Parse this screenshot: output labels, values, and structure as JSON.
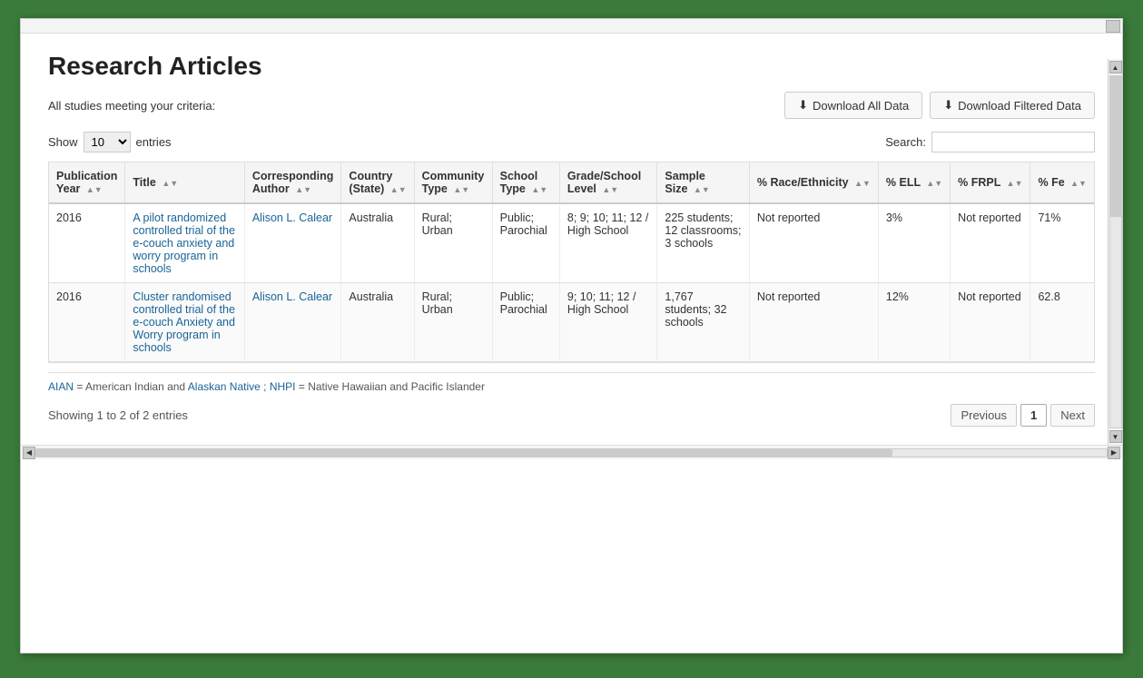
{
  "page": {
    "title": "Research Articles",
    "criteria_label": "All studies meeting your criteria:",
    "btn_download_all": "Download All Data",
    "btn_download_filtered": "Download Filtered Data",
    "show_label": "Show",
    "entries_label": "entries",
    "show_value": "10",
    "search_label": "Search:",
    "search_placeholder": ""
  },
  "table": {
    "columns": [
      {
        "id": "pub_year",
        "label": "Publication\nYear",
        "sortable": true
      },
      {
        "id": "title",
        "label": "Title",
        "sortable": true
      },
      {
        "id": "corresponding_author",
        "label": "Corresponding\nAuthor",
        "sortable": true
      },
      {
        "id": "country",
        "label": "Country\n(State)",
        "sortable": true
      },
      {
        "id": "community_type",
        "label": "Community\nType",
        "sortable": true
      },
      {
        "id": "school_type",
        "label": "School\nType",
        "sortable": true
      },
      {
        "id": "grade_level",
        "label": "Grade/School\nLevel",
        "sortable": true
      },
      {
        "id": "sample_size",
        "label": "Sample\nSize",
        "sortable": true
      },
      {
        "id": "race_ethnicity",
        "label": "% Race/Ethnicity",
        "sortable": true
      },
      {
        "id": "ell",
        "label": "% ELL",
        "sortable": true
      },
      {
        "id": "frpl",
        "label": "% FRPL",
        "sortable": true
      },
      {
        "id": "female",
        "label": "% Fe",
        "sortable": true
      }
    ],
    "rows": [
      {
        "pub_year": "2016",
        "title": "A pilot randomized controlled trial of the e-couch anxiety and worry program in schools",
        "corresponding_author": "Alison L. Calear",
        "country": "Australia",
        "community_type": "Rural; Urban",
        "school_type": "Public; Parochial",
        "grade_level": "8; 9; 10; 11; 12 / High School",
        "sample_size": "225 students; 12 classrooms; 3 schools",
        "race_ethnicity": "Not reported",
        "ell": "3%",
        "frpl": "Not reported",
        "female": "71%"
      },
      {
        "pub_year": "2016",
        "title": "Cluster randomised controlled trial of the e-couch Anxiety and Worry program in schools",
        "corresponding_author": "Alison L. Calear",
        "country": "Australia",
        "community_type": "Rural; Urban",
        "school_type": "Public; Parochial",
        "grade_level": "9; 10; 11; 12 / High School",
        "sample_size": "1,767 students; 32 schools",
        "race_ethnicity": "Not reported",
        "ell": "12%",
        "frpl": "Not reported",
        "female": "62.8"
      }
    ]
  },
  "footnote": {
    "text": "AIAN = American Indian and Alaskan Native; NHPI = Native Hawaiian and Pacific Islander",
    "aian_label": "AIAN",
    "aian_def": "American Indian and",
    "alaskan_label": "Alaskan Native",
    "nhpi_label": "NHPI",
    "nhpi_def": "Native Hawaiian and Pacific Islander"
  },
  "pagination": {
    "info": "Showing 1 to 2 of 2 entries",
    "prev_label": "Previous",
    "next_label": "Next",
    "current_page": "1",
    "pages": [
      "1"
    ]
  }
}
